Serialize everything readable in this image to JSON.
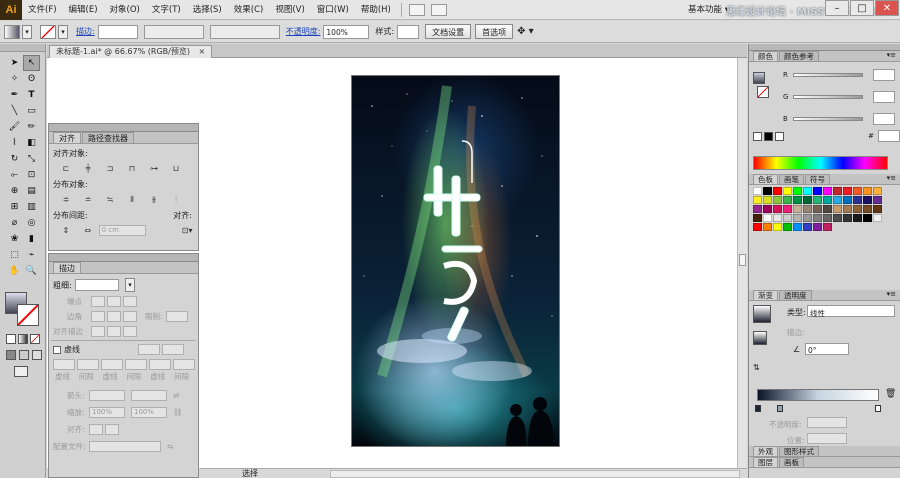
{
  "app": {
    "logo": "Ai",
    "workspace": "基本功能 ▾",
    "watermark": "思缘设计论坛 · MISSYUAN.COM"
  },
  "menu": [
    "文件(F)",
    "编辑(E)",
    "对象(O)",
    "文字(T)",
    "选择(S)",
    "效果(C)",
    "视图(V)",
    "窗口(W)",
    "帮助(H)"
  ],
  "window_controls": [
    "–",
    "□",
    "✕"
  ],
  "control_bar": {
    "stroke_label": "描边:",
    "opacity_label": "不透明度:",
    "opacity_value": "100%",
    "style_label": "样式:",
    "doc_setup": "文档设置",
    "preferences": "首选项"
  },
  "document": {
    "tab_title": "未标题-1.ai* @ 66.67% (RGB/预览)",
    "close": "×",
    "status_zoom": "",
    "status_label": "选择"
  },
  "align_panel": {
    "tabs": [
      "对齐",
      "路径查找器"
    ],
    "align_objects": "对齐对象:",
    "distribute_objects": "分布对象:",
    "distribute_spacing": "分布间距:",
    "align_to": "对齐:",
    "spacing_value": "0 cm"
  },
  "stroke_panel": {
    "tab": "描边",
    "weight_label": "粗细:",
    "cap_label": "端点",
    "corner_label": "边角",
    "limit_label": "限制:",
    "align_stroke_label": "对齐描边",
    "dashed_label": "虚线",
    "dash_labels": [
      "虚线",
      "间隙",
      "虚线",
      "间隙",
      "虚线",
      "间隙"
    ],
    "arrowheads_label": "箭头:",
    "scale_label": "缩放:",
    "scale_value_1": "100%",
    "scale_value_2": "100%",
    "align_label": "对齐:",
    "profile_label": "配置文件:"
  },
  "color_panel": {
    "tabs": [
      "颜色",
      "颜色参考"
    ],
    "channels": [
      "R",
      "G",
      "B"
    ],
    "hex_label": "#"
  },
  "swatches_panel": {
    "tabs": [
      "色板",
      "画笔",
      "符号"
    ]
  },
  "gradient_panel": {
    "tabs": [
      "渐变",
      "透明度"
    ],
    "type_label": "类型:",
    "type_value": "线性",
    "stroke_label": "描边:",
    "angle_value": "0°",
    "opacity_label": "不透明度:",
    "location_label": "位置:"
  },
  "appearance_panel": {
    "tabs": [
      "外观",
      "图形样式"
    ],
    "bottom_tabs": [
      "图层",
      "画板"
    ]
  },
  "colors": {
    "swatch_row1": [
      "#ffffff",
      "#000000",
      "#ff0000",
      "#ffff00",
      "#00ff00",
      "#00ffff",
      "#0000ff",
      "#ff00ff",
      "#c1272d",
      "#ed1c24",
      "#f15a24",
      "#f7931e",
      "#fbb03b"
    ],
    "swatch_row2": [
      "#fcee21",
      "#d9e021",
      "#8cc63f",
      "#39b54a",
      "#009245",
      "#006837",
      "#22b573",
      "#00a99d",
      "#29abe2",
      "#0071bc",
      "#2e3192",
      "#1b1464",
      "#662d91"
    ],
    "swatch_row3": [
      "#93278f",
      "#9e005d",
      "#d4145a",
      "#ed1e79",
      "#c7b299",
      "#998675",
      "#736357",
      "#534741",
      "#c69c6d",
      "#a67c52",
      "#8c6239",
      "#754c24",
      "#603813"
    ],
    "swatch_row4": [
      "#42210b",
      "#ffffff",
      "#e6e6e6",
      "#cccccc",
      "#b3b3b3",
      "#999999",
      "#808080",
      "#666666",
      "#4d4d4d",
      "#333333",
      "#1a1a1a",
      "#000000",
      "#f0f0f0"
    ],
    "swatch_row5": [
      "#ff0000",
      "#ff7f00",
      "#ffff00",
      "#00c000",
      "#0090ff",
      "#3040c0",
      "#8020a0",
      "#c02060"
    ]
  }
}
